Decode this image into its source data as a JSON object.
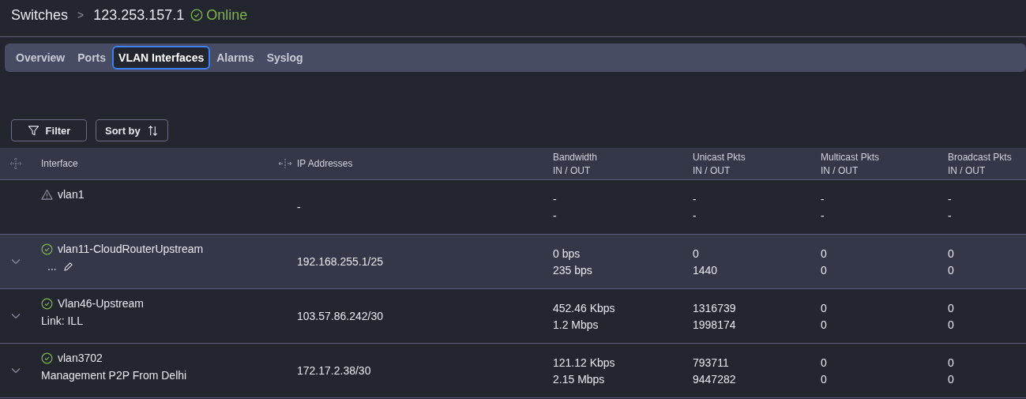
{
  "breadcrumb": {
    "parent": "Switches",
    "separator": ">",
    "current": "123.253.157.1",
    "online": true,
    "status_label": "Online"
  },
  "tabs": [
    {
      "label": "Overview",
      "selected": false
    },
    {
      "label": "Ports",
      "selected": false
    },
    {
      "label": "VLAN Interfaces",
      "selected": true
    },
    {
      "label": "Alarms",
      "selected": false
    },
    {
      "label": "Syslog",
      "selected": false
    }
  ],
  "toolbar": {
    "filter": "Filter",
    "sort": "Sort by"
  },
  "table": {
    "columns": [
      {
        "label": "Interface"
      },
      {
        "label": "IP Addresses",
        "resizable": true
      },
      {
        "label": "Bandwidth",
        "sub": "IN / OUT"
      },
      {
        "label": "Unicast Pkts",
        "sub": "IN / OUT"
      },
      {
        "label": "Multicast Pkts",
        "sub": "IN / OUT"
      },
      {
        "label": "Broadcast Pkts",
        "sub": "IN / OUT"
      }
    ],
    "rows": [
      {
        "kind": "warning",
        "expandable": false,
        "selected": false,
        "name": "vlan1",
        "ip": "-",
        "bandwidth": [
          "-",
          "-"
        ],
        "unicast": [
          "-",
          "-"
        ],
        "multicast": [
          "-",
          "-"
        ],
        "broadcast": [
          "-",
          "-"
        ]
      },
      {
        "kind": "up",
        "expandable": true,
        "selected": true,
        "name": "vlan11-CloudRouterUpstream",
        "description": "...",
        "editable": true,
        "ip": "192.168.255.1/25",
        "bandwidth": [
          "0 bps",
          "235 bps"
        ],
        "unicast": [
          "0",
          "1440"
        ],
        "multicast": [
          "0",
          "0"
        ],
        "broadcast": [
          "0",
          "0"
        ]
      },
      {
        "kind": "up",
        "expandable": true,
        "selected": false,
        "name": "Vlan46-Upstream",
        "description": "Link: ILL",
        "ip": "103.57.86.242/30",
        "bandwidth": [
          "452.46 Kbps",
          "1.2 Mbps"
        ],
        "unicast": [
          "1316739",
          "1998174"
        ],
        "multicast": [
          "0",
          "0"
        ],
        "broadcast": [
          "0",
          "0"
        ]
      },
      {
        "kind": "up",
        "expandable": true,
        "selected": false,
        "name": "vlan3702",
        "description": "Management P2P From Delhi",
        "ip": "172.17.2.38/30",
        "bandwidth": [
          "121.12 Kbps",
          "2.15 Mbps"
        ],
        "unicast": [
          "793711",
          "9447282"
        ],
        "multicast": [
          "0",
          "0"
        ],
        "broadcast": [
          "0",
          "0"
        ]
      }
    ]
  }
}
